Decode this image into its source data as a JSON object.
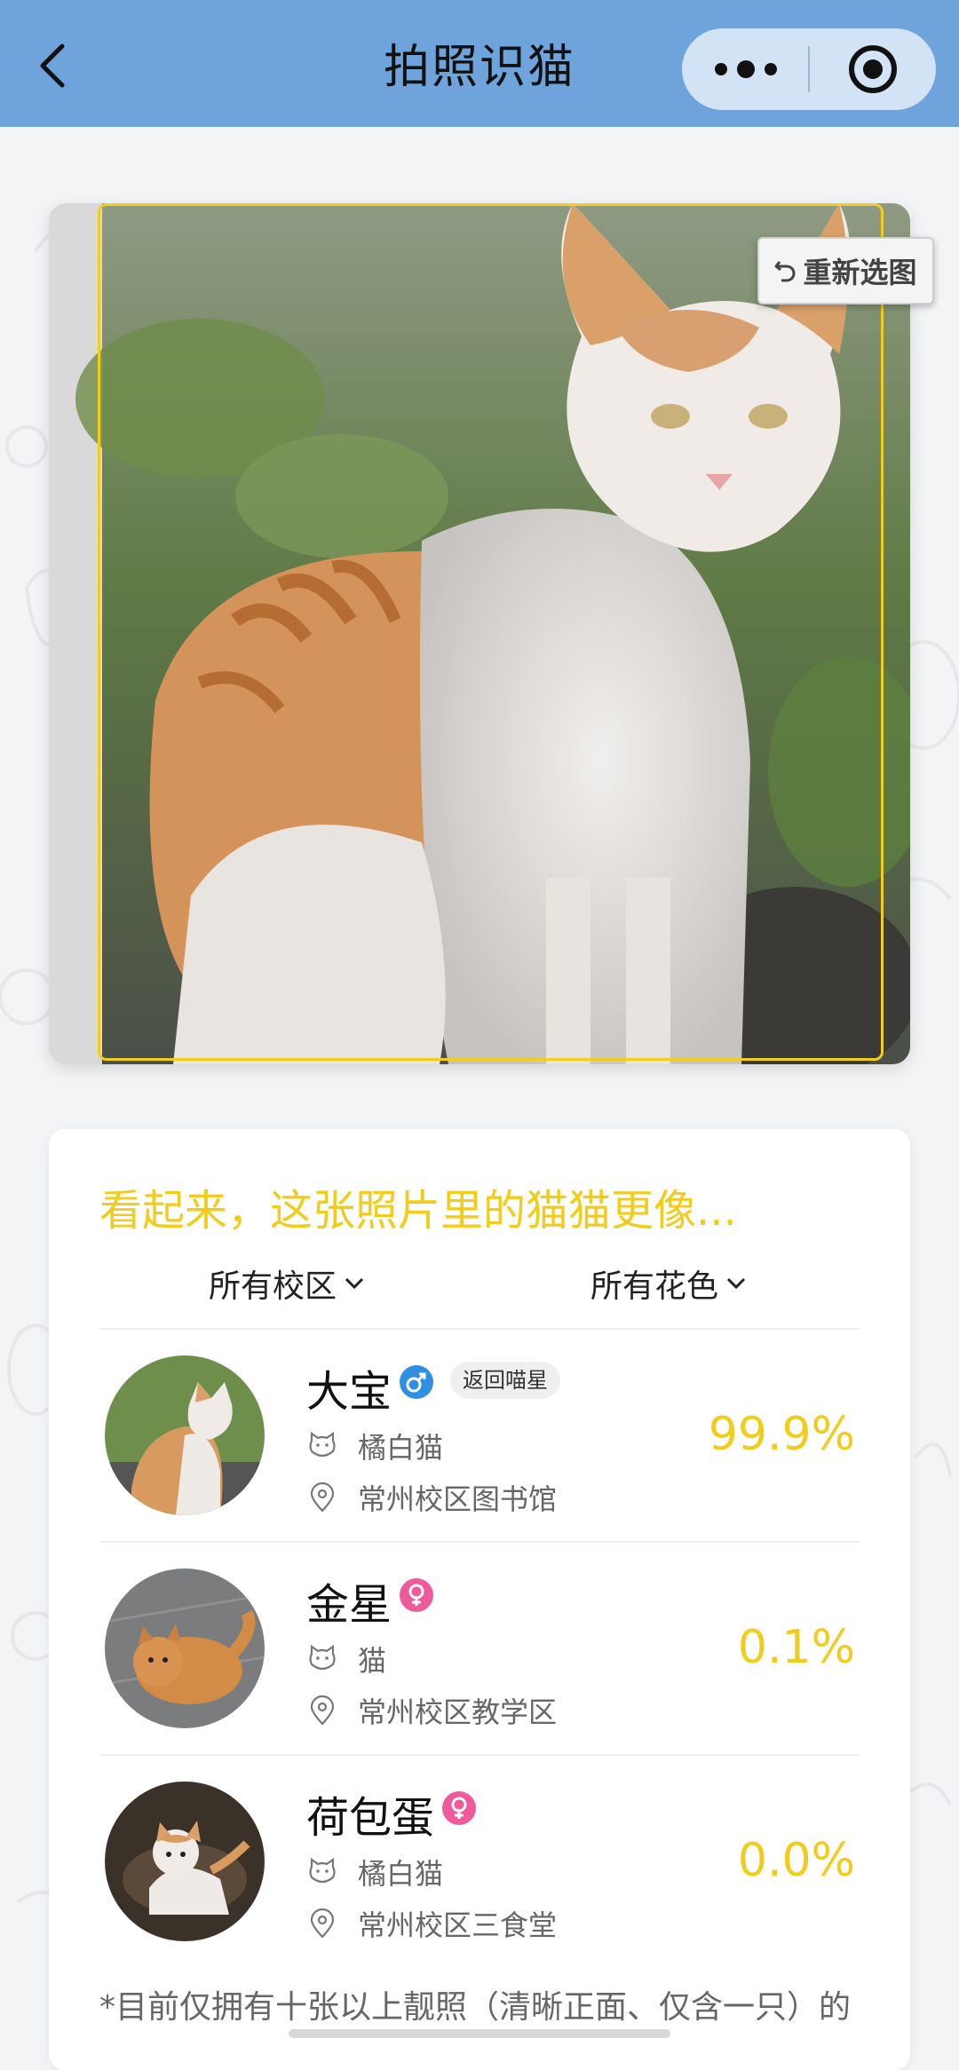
{
  "nav": {
    "title": "拍照识猫"
  },
  "photo": {
    "reselect_label": "重新选图"
  },
  "result": {
    "heading": "看起来，这张照片里的猫猫更像...",
    "filters": {
      "campus": "所有校区",
      "color": "所有花色"
    },
    "cats": [
      {
        "name": "大宝",
        "gender": "male",
        "tag": "返回喵星",
        "breed": "橘白猫",
        "location": "常州校区图书馆",
        "score": "99.9%"
      },
      {
        "name": "金星",
        "gender": "female",
        "tag": "",
        "breed": "猫",
        "location": "常州校区教学区",
        "score": "0.1%"
      },
      {
        "name": "荷包蛋",
        "gender": "female",
        "tag": "",
        "breed": "橘白猫",
        "location": "常州校区三食堂",
        "score": "0.0%"
      }
    ],
    "footnote": "*目前仅拥有十张以上靓照（清晰正面、仅含一只）的"
  },
  "colors": {
    "navbar": "#6fa3dc",
    "accent_yellow": "#f2cc1a",
    "male_blue": "#2f8fe0",
    "female_pink": "#ee5a9a"
  }
}
